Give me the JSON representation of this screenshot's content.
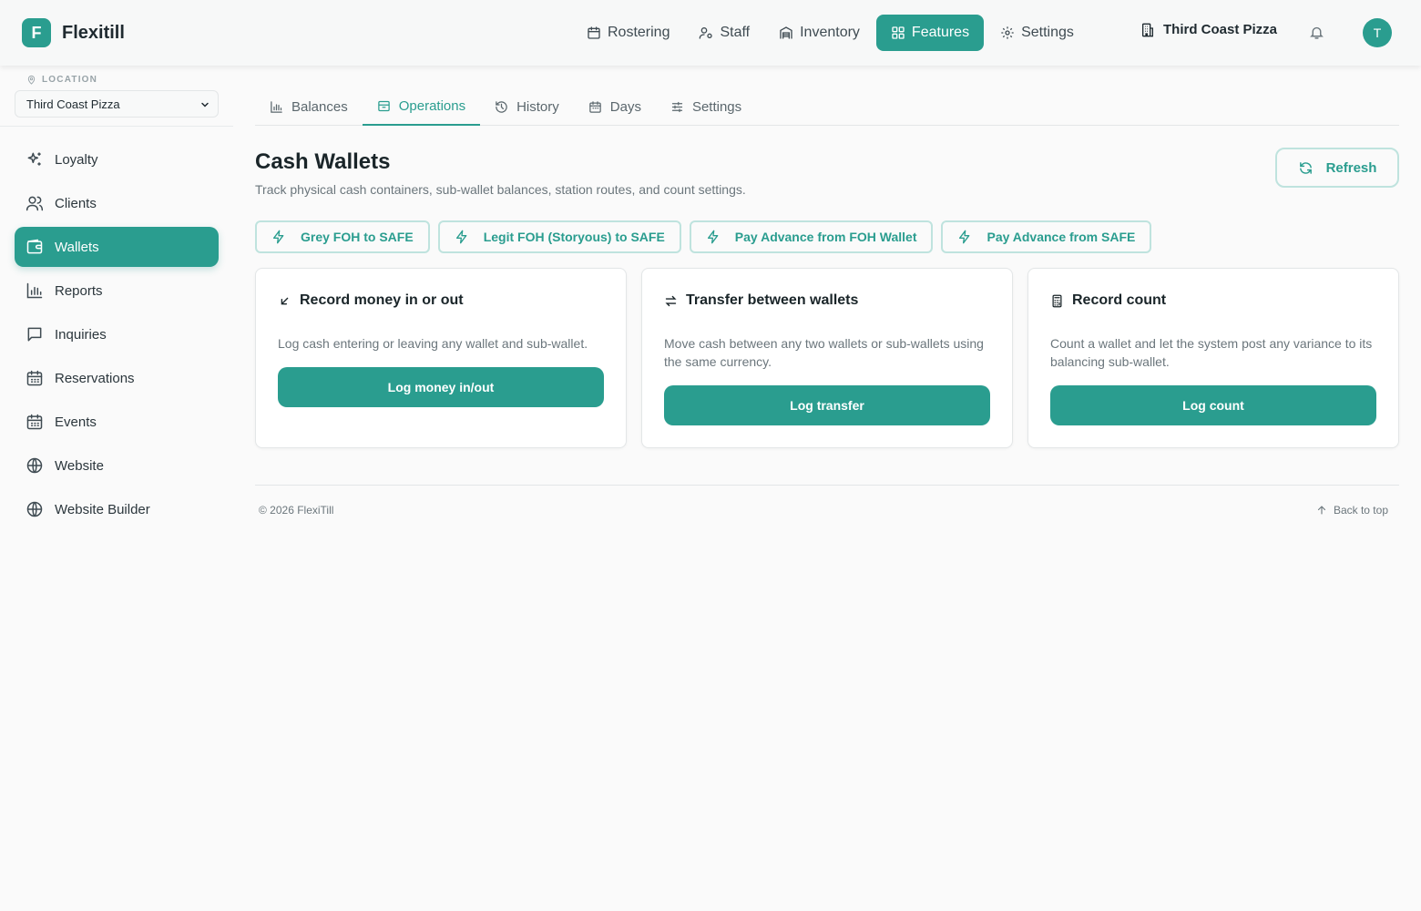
{
  "app": {
    "logo_letter": "F",
    "name": "Flexitill"
  },
  "topnav": {
    "items": [
      {
        "label": "Rostering",
        "icon": "calendar-icon"
      },
      {
        "label": "Staff",
        "icon": "user-cog-icon"
      },
      {
        "label": "Inventory",
        "icon": "warehouse-icon"
      },
      {
        "label": "Features",
        "icon": "grid-icon",
        "active": true
      },
      {
        "label": "Settings",
        "icon": "gear-icon"
      }
    ],
    "location": "Third Coast Pizza",
    "avatar": "T"
  },
  "sidebar": {
    "location_label": "LOCATION",
    "location_value": "Third Coast Pizza",
    "items": [
      {
        "label": "Loyalty",
        "icon": "sparkles-icon"
      },
      {
        "label": "Clients",
        "icon": "users-icon"
      },
      {
        "label": "Wallets",
        "icon": "wallet-icon",
        "active": true
      },
      {
        "label": "Reports",
        "icon": "bar-chart-icon"
      },
      {
        "label": "Inquiries",
        "icon": "message-icon"
      },
      {
        "label": "Reservations",
        "icon": "calendar-grid-icon"
      },
      {
        "label": "Events",
        "icon": "calendar-grid-icon"
      },
      {
        "label": "Website",
        "icon": "globe-icon"
      },
      {
        "label": "Website Builder",
        "icon": "globe-icon"
      }
    ]
  },
  "tabs": [
    {
      "label": "Balances",
      "icon": "bar-chart-icon"
    },
    {
      "label": "Operations",
      "icon": "archive-icon",
      "active": true
    },
    {
      "label": "History",
      "icon": "history-icon"
    },
    {
      "label": "Days",
      "icon": "calendar-grid-icon"
    },
    {
      "label": "Settings",
      "icon": "sliders-icon"
    }
  ],
  "page": {
    "title": "Cash Wallets",
    "subtitle": "Track physical cash containers, sub-wallet balances, station routes, and count settings.",
    "refresh_label": "Refresh"
  },
  "quick_actions": [
    "Grey FOH to SAFE",
    "Legit FOH (Storyous) to SAFE",
    "Pay Advance from FOH Wallet",
    "Pay Advance from SAFE"
  ],
  "cards": [
    {
      "title": "Record money in or out",
      "icon": "arrow-down-left-icon",
      "description": "Log cash entering or leaving any wallet and sub-wallet.",
      "button": "Log money in/out"
    },
    {
      "title": "Transfer between wallets",
      "icon": "transfer-icon",
      "description": "Move cash between any two wallets or sub-wallets using the same currency.",
      "button": "Log transfer"
    },
    {
      "title": "Record count",
      "icon": "calculator-icon",
      "description": "Count a wallet and let the system post any variance to its balancing sub-wallet.",
      "button": "Log count"
    }
  ],
  "footer": {
    "copyright": "© 2026 FlexiTill",
    "back_to_top": "Back to top"
  },
  "colors": {
    "accent": "#2a9d8f",
    "accent_border": "#bfe3de",
    "background": "#fafafa"
  }
}
